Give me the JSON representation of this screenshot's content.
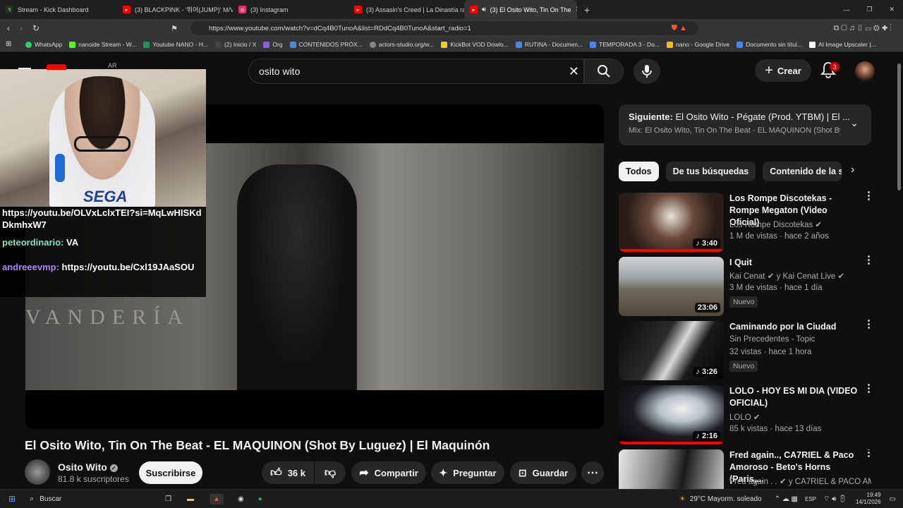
{
  "browser": {
    "tabs": [
      {
        "label": "Stream - Kick Dashboard",
        "color": "#53fc18"
      },
      {
        "label": "(3) BLACKPINK - '뛰어(JUMP)' M/V -",
        "color": "#ff0000"
      },
      {
        "label": "(3) Instagram",
        "color": "#e1306c"
      },
      {
        "label": "(3) Assasin's Creed | La Dinastía rap 2",
        "color": "#ff0000"
      },
      {
        "label": "(3) El Osito Wito, Tin On The",
        "color": "#ff0000"
      }
    ],
    "url": "https://www.youtube.com/watch?v=dCq4B0TunoA&list=RDdCq4B0TunoA&start_radio=1",
    "bookmarks": [
      {
        "label": "WhatsApp",
        "color": "#25d366"
      },
      {
        "label": "nanoide Stream - W...",
        "color": "#53fc18"
      },
      {
        "label": "Youtube NANO - H...",
        "color": "#0f9d58"
      },
      {
        "label": "(2) Inicio / X",
        "color": "#444444"
      },
      {
        "label": "Org",
        "color": "#8b5cf6"
      },
      {
        "label": "CONTENIDOS PRÓX...",
        "color": "#4285f4"
      },
      {
        "label": "actors-studio.org/w...",
        "color": "#888888"
      },
      {
        "label": "KickBot VOD Dowlo...",
        "color": "#facc15"
      },
      {
        "label": "RUTINA - Documen...",
        "color": "#4285f4"
      },
      {
        "label": "TEMPORADA 3 - Do...",
        "color": "#4285f4"
      },
      {
        "label": "nano - Google Drive",
        "color": "#fbbc04"
      },
      {
        "label": "Documento sin títul...",
        "color": "#4285f4"
      },
      {
        "label": "AI Image Upscaler |...",
        "color": "#ffffff"
      }
    ]
  },
  "youtube": {
    "logo_region": "AR",
    "search_value": "osito wito",
    "create_label": "Crear",
    "notifications": "3"
  },
  "overlay": {
    "chat": [
      {
        "user": "",
        "text": "https://youtu.be/OLVxLclxTEI?si=MqLwHISKdDkmhxW7"
      },
      {
        "user": "peteordinario:",
        "text": "VA"
      },
      {
        "user": "andreeevmp:",
        "text": "https://youtu.be/Cxl19JAaSOU"
      }
    ]
  },
  "video": {
    "title": "El Osito Wito, Tin On The Beat - EL MAQUINON (Shot By Luguez) | El Maquinón",
    "channel": "Osito Wito",
    "subscribers": "81.8 k suscriptores",
    "subscribe_label": "Suscribirse",
    "likes": "36 k",
    "share_label": "Compartir",
    "ask_label": "Preguntar",
    "save_label": "Guardar"
  },
  "upnext": {
    "label": "Siguiente:",
    "title": "El Osito Wito - Pégate (Prod. YTBM) | El ...",
    "mix": "Mix: El Osito Wito, Tin On The Beat - EL MAQUINON (Shot By ..."
  },
  "chips": [
    "Todos",
    "De tus búsquedas",
    "Contenido de la ser"
  ],
  "recommendations": [
    {
      "title": "Los Rompe Discotekas - Rompe Megaton (Video Oficial)",
      "channel": "Los Rompe Discotekas",
      "meta": "1 M de vistas · hace 2 años",
      "duration": "3:40",
      "nuevo": "",
      "progress": 1.0
    },
    {
      "title": "I Quit",
      "channel": "Kai Cenat",
      "channel2": "y Kai Cenat Live",
      "meta": "3 M de vistas · hace 1 día",
      "duration": "23:06",
      "nuevo": "Nuevo",
      "progress": 0
    },
    {
      "title": "Caminando por la Ciudad",
      "channel": "Sin Precedentes - Topic",
      "meta": "32 vistas · hace 1 hora",
      "duration": "3:26",
      "nuevo": "Nuevo",
      "progress": 0
    },
    {
      "title": "LOLO - HOY ES MI DIA (VIDEO OFICIAL)",
      "channel": "LOLO",
      "meta": "85 k vistas · hace 13 días",
      "duration": "2:16",
      "nuevo": "",
      "progress": 1.0
    },
    {
      "title": "Fred again.., CA7RIEL & Paco Amoroso - Beto's Horns (Paris,...",
      "channel": "Fred again . .",
      "channel2": "y CA7RIEL & PACO AMO...",
      "meta": "",
      "duration": "",
      "nuevo": "",
      "progress": 0
    }
  ],
  "taskbar": {
    "search": "Buscar",
    "weather": "29°C  Mayorm. soleado",
    "lang": "ESP",
    "time": "19:49",
    "date": "14/1/2026"
  }
}
